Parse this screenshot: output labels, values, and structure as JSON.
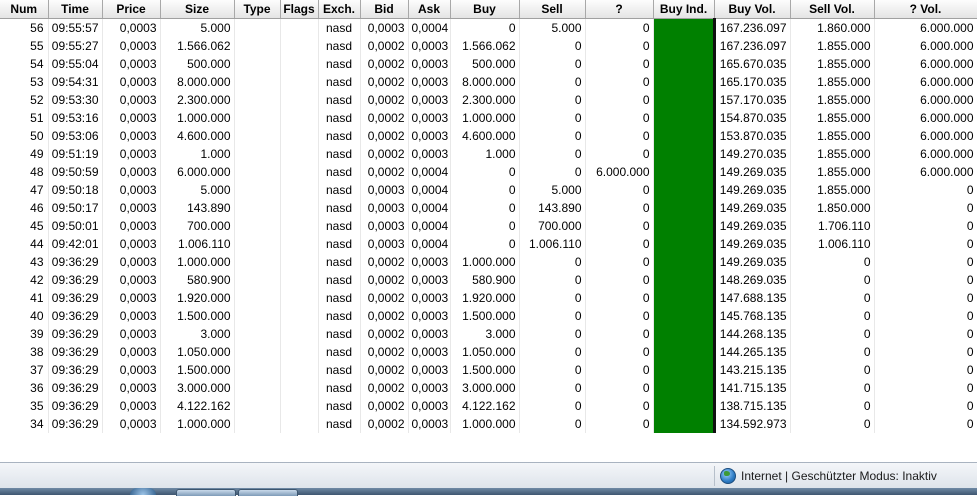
{
  "columns": [
    "Num",
    "Time",
    "Price",
    "Size",
    "Type",
    "Flags",
    "Exch.",
    "Bid",
    "Ask",
    "Buy",
    "Sell",
    "?",
    "Buy Ind.",
    "Buy Vol.",
    "Sell Vol.",
    "? Vol."
  ],
  "rows": [
    [
      "56",
      "09:55:57",
      "0,0003",
      "5.000",
      "",
      "",
      "nasd",
      "0,0003",
      "0,0004",
      "0",
      "5.000",
      "0",
      "",
      "167.236.097",
      "1.860.000",
      "6.000.000"
    ],
    [
      "55",
      "09:55:27",
      "0,0003",
      "1.566.062",
      "",
      "",
      "nasd",
      "0,0002",
      "0,0003",
      "1.566.062",
      "0",
      "0",
      "",
      "167.236.097",
      "1.855.000",
      "6.000.000"
    ],
    [
      "54",
      "09:55:04",
      "0,0003",
      "500.000",
      "",
      "",
      "nasd",
      "0,0002",
      "0,0003",
      "500.000",
      "0",
      "0",
      "",
      "165.670.035",
      "1.855.000",
      "6.000.000"
    ],
    [
      "53",
      "09:54:31",
      "0,0003",
      "8.000.000",
      "",
      "",
      "nasd",
      "0,0002",
      "0,0003",
      "8.000.000",
      "0",
      "0",
      "",
      "165.170.035",
      "1.855.000",
      "6.000.000"
    ],
    [
      "52",
      "09:53:30",
      "0,0003",
      "2.300.000",
      "",
      "",
      "nasd",
      "0,0002",
      "0,0003",
      "2.300.000",
      "0",
      "0",
      "",
      "157.170.035",
      "1.855.000",
      "6.000.000"
    ],
    [
      "51",
      "09:53:16",
      "0,0003",
      "1.000.000",
      "",
      "",
      "nasd",
      "0,0002",
      "0,0003",
      "1.000.000",
      "0",
      "0",
      "",
      "154.870.035",
      "1.855.000",
      "6.000.000"
    ],
    [
      "50",
      "09:53:06",
      "0,0003",
      "4.600.000",
      "",
      "",
      "nasd",
      "0,0002",
      "0,0003",
      "4.600.000",
      "0",
      "0",
      "",
      "153.870.035",
      "1.855.000",
      "6.000.000"
    ],
    [
      "49",
      "09:51:19",
      "0,0003",
      "1.000",
      "",
      "",
      "nasd",
      "0,0002",
      "0,0003",
      "1.000",
      "0",
      "0",
      "",
      "149.270.035",
      "1.855.000",
      "6.000.000"
    ],
    [
      "48",
      "09:50:59",
      "0,0003",
      "6.000.000",
      "",
      "",
      "nasd",
      "0,0002",
      "0,0004",
      "0",
      "0",
      "6.000.000",
      "",
      "149.269.035",
      "1.855.000",
      "6.000.000"
    ],
    [
      "47",
      "09:50:18",
      "0,0003",
      "5.000",
      "",
      "",
      "nasd",
      "0,0003",
      "0,0004",
      "0",
      "5.000",
      "0",
      "",
      "149.269.035",
      "1.855.000",
      "0"
    ],
    [
      "46",
      "09:50:17",
      "0,0003",
      "143.890",
      "",
      "",
      "nasd",
      "0,0003",
      "0,0004",
      "0",
      "143.890",
      "0",
      "",
      "149.269.035",
      "1.850.000",
      "0"
    ],
    [
      "45",
      "09:50:01",
      "0,0003",
      "700.000",
      "",
      "",
      "nasd",
      "0,0003",
      "0,0004",
      "0",
      "700.000",
      "0",
      "",
      "149.269.035",
      "1.706.110",
      "0"
    ],
    [
      "44",
      "09:42:01",
      "0,0003",
      "1.006.110",
      "",
      "",
      "nasd",
      "0,0003",
      "0,0004",
      "0",
      "1.006.110",
      "0",
      "",
      "149.269.035",
      "1.006.110",
      "0"
    ],
    [
      "43",
      "09:36:29",
      "0,0003",
      "1.000.000",
      "",
      "",
      "nasd",
      "0,0002",
      "0,0003",
      "1.000.000",
      "0",
      "0",
      "",
      "149.269.035",
      "0",
      "0"
    ],
    [
      "42",
      "09:36:29",
      "0,0003",
      "580.900",
      "",
      "",
      "nasd",
      "0,0002",
      "0,0003",
      "580.900",
      "0",
      "0",
      "",
      "148.269.035",
      "0",
      "0"
    ],
    [
      "41",
      "09:36:29",
      "0,0003",
      "1.920.000",
      "",
      "",
      "nasd",
      "0,0002",
      "0,0003",
      "1.920.000",
      "0",
      "0",
      "",
      "147.688.135",
      "0",
      "0"
    ],
    [
      "40",
      "09:36:29",
      "0,0003",
      "1.500.000",
      "",
      "",
      "nasd",
      "0,0002",
      "0,0003",
      "1.500.000",
      "0",
      "0",
      "",
      "145.768.135",
      "0",
      "0"
    ],
    [
      "39",
      "09:36:29",
      "0,0003",
      "3.000",
      "",
      "",
      "nasd",
      "0,0002",
      "0,0003",
      "3.000",
      "0",
      "0",
      "",
      "144.268.135",
      "0",
      "0"
    ],
    [
      "38",
      "09:36:29",
      "0,0003",
      "1.050.000",
      "",
      "",
      "nasd",
      "0,0002",
      "0,0003",
      "1.050.000",
      "0",
      "0",
      "",
      "144.265.135",
      "0",
      "0"
    ],
    [
      "37",
      "09:36:29",
      "0,0003",
      "1.500.000",
      "",
      "",
      "nasd",
      "0,0002",
      "0,0003",
      "1.500.000",
      "0",
      "0",
      "",
      "143.215.135",
      "0",
      "0"
    ],
    [
      "36",
      "09:36:29",
      "0,0003",
      "3.000.000",
      "",
      "",
      "nasd",
      "0,0002",
      "0,0003",
      "3.000.000",
      "0",
      "0",
      "",
      "141.715.135",
      "0",
      "0"
    ],
    [
      "35",
      "09:36:29",
      "0,0003",
      "4.122.162",
      "",
      "",
      "nasd",
      "0,0002",
      "0,0003",
      "4.122.162",
      "0",
      "0",
      "",
      "138.715.135",
      "0",
      "0"
    ],
    [
      "34",
      "09:36:29",
      "0,0003",
      "1.000.000",
      "",
      "",
      "nasd",
      "0,0002",
      "0,0003",
      "1.000.000",
      "0",
      "0",
      "",
      "134.592.973",
      "0",
      "0"
    ]
  ],
  "buy_indicator_color": "#008000",
  "status_bar": {
    "zone_icon": "internet-globe-icon",
    "zone_text": "Internet | Geschützter Modus: Inaktiv"
  }
}
